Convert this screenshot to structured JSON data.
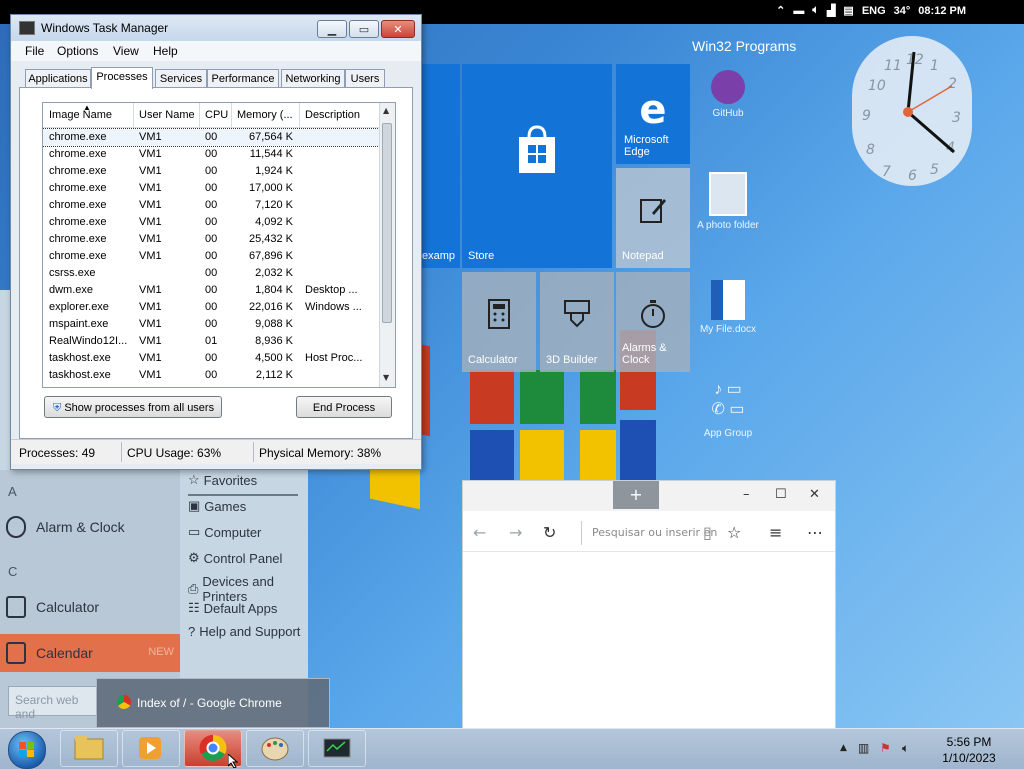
{
  "top_status": {
    "lang": "ENG",
    "temp": "34°",
    "time": "08:12 PM"
  },
  "start_menu": {
    "letter_a": "A",
    "letter_c": "C",
    "apps": [
      {
        "label": "Alarm & Clock"
      },
      {
        "label": "Calculator"
      },
      {
        "label": "Calendar",
        "tag": "NEW"
      }
    ],
    "links": [
      "Favorites",
      "Games",
      "Computer",
      "Control Panel",
      "Devices and Printers",
      "Default Apps",
      "Help and Support"
    ],
    "search_placeholder": "Search web and"
  },
  "tiles": {
    "left_partial_label": "examp",
    "store": "Store",
    "edge": "Microsoft Edge",
    "notepad": "Notepad",
    "calculator": "Calculator",
    "builder": "3D Builder",
    "alarms": "Alarms & Clock"
  },
  "win32": {
    "title": "Win32 Programs",
    "items": [
      "GitHub",
      "A photo folder",
      "My File.docx",
      "App Group"
    ]
  },
  "clock": {
    "numbers": [
      "12",
      "1",
      "2",
      "3",
      "4",
      "5",
      "6",
      "7",
      "8",
      "9",
      "10",
      "11"
    ]
  },
  "edge_window": {
    "new_tab": "+",
    "minimize": "–",
    "maximize": "☐",
    "close": "✕",
    "address_placeholder": "Pesquisar ou inserir en"
  },
  "task_manager": {
    "title": "Windows Task Manager",
    "minimize": "▁",
    "maximize": "▭",
    "close": "✕",
    "menu": [
      "File",
      "Options",
      "View",
      "Help"
    ],
    "tabs": [
      "Applications",
      "Processes",
      "Services",
      "Performance",
      "Networking",
      "Users"
    ],
    "active_tab": "Processes",
    "columns": [
      "Image Name",
      "User Name",
      "CPU",
      "Memory (...",
      "Description"
    ],
    "rows": [
      {
        "name": "chrome.exe",
        "user": "VM1",
        "cpu": "00",
        "mem": "67,564 K",
        "desc": ""
      },
      {
        "name": "chrome.exe",
        "user": "VM1",
        "cpu": "00",
        "mem": "11,544 K",
        "desc": ""
      },
      {
        "name": "chrome.exe",
        "user": "VM1",
        "cpu": "00",
        "mem": "1,924 K",
        "desc": ""
      },
      {
        "name": "chrome.exe",
        "user": "VM1",
        "cpu": "00",
        "mem": "17,000 K",
        "desc": ""
      },
      {
        "name": "chrome.exe",
        "user": "VM1",
        "cpu": "00",
        "mem": "7,120 K",
        "desc": ""
      },
      {
        "name": "chrome.exe",
        "user": "VM1",
        "cpu": "00",
        "mem": "4,092 K",
        "desc": ""
      },
      {
        "name": "chrome.exe",
        "user": "VM1",
        "cpu": "00",
        "mem": "25,432 K",
        "desc": ""
      },
      {
        "name": "chrome.exe",
        "user": "VM1",
        "cpu": "00",
        "mem": "67,896 K",
        "desc": ""
      },
      {
        "name": "csrss.exe",
        "user": "",
        "cpu": "00",
        "mem": "2,032 K",
        "desc": ""
      },
      {
        "name": "dwm.exe",
        "user": "VM1",
        "cpu": "00",
        "mem": "1,804 K",
        "desc": "Desktop ..."
      },
      {
        "name": "explorer.exe",
        "user": "VM1",
        "cpu": "00",
        "mem": "22,016 K",
        "desc": "Windows ..."
      },
      {
        "name": "mspaint.exe",
        "user": "VM1",
        "cpu": "00",
        "mem": "9,088 K",
        "desc": ""
      },
      {
        "name": "RealWindo12I...",
        "user": "VM1",
        "cpu": "01",
        "mem": "8,936 K",
        "desc": ""
      },
      {
        "name": "taskhost.exe",
        "user": "VM1",
        "cpu": "00",
        "mem": "4,500 K",
        "desc": "Host Proc..."
      },
      {
        "name": "taskhost.exe",
        "user": "VM1",
        "cpu": "00",
        "mem": "2,112 K",
        "desc": ""
      }
    ],
    "show_all_button": "Show processes from all users",
    "end_process_button": "End Process",
    "status": {
      "processes": "Processes: 49",
      "cpu": "CPU Usage: 63%",
      "memory": "Physical Memory: 38%"
    }
  },
  "chrome_tooltip": "Index of / - Google Chrome",
  "taskbar": {
    "time": "5:56 PM",
    "date": "1/10/2023"
  }
}
